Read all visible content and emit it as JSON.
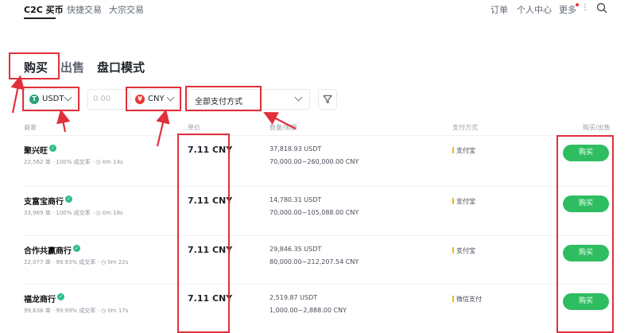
{
  "topnav": {
    "brand": "C2C 买币",
    "tabs": [
      "快捷交易",
      "大宗交易"
    ],
    "orders": "订单",
    "profile": "个人中心",
    "more": "更多"
  },
  "modes": {
    "buy": "购买",
    "sell": "出售",
    "book": "盘口模式"
  },
  "filters": {
    "coin": "USDT",
    "amount_placeholder": "0.00",
    "currency": "CNY",
    "payment": "全部支付方式"
  },
  "table": {
    "headers": {
      "merchant": "商家",
      "price": "单价",
      "qty_limit": "数量/限额",
      "payment": "支付方式",
      "action": "购买/出售"
    },
    "rows": [
      {
        "merchant": "聚兴旺",
        "stats": "22,562 单 · 100% 成交率 · ◷ 0m 14s",
        "price": "7.11 CNY",
        "qty": "37,818.93 USDT",
        "limit": "70,000.00~260,000.00 CNY",
        "pay": "支付宝",
        "btn": "购买"
      },
      {
        "merchant": "支富宝商行",
        "stats": "33,969 单 · 100% 成交率 · ◷ 0m 18s",
        "price": "7.11 CNY",
        "qty": "14,780.31 USDT",
        "limit": "70,000.00~105,088.00 CNY",
        "pay": "支付宝",
        "btn": "购买"
      },
      {
        "merchant": "合作共赢商行",
        "stats": "22,077 单 · 99.93% 成交率 · ◷ 0m 22s",
        "price": "7.11 CNY",
        "qty": "29,846.35 USDT",
        "limit": "80,000.00~212,207.54 CNY",
        "pay": "支付宝",
        "btn": "购买"
      },
      {
        "merchant": "福龙商行",
        "stats": "99,638 单 · 99.99% 成交率 · ◷ 0m 17s",
        "price": "7.11 CNY",
        "qty": "2,519.87 USDT",
        "limit": "1,000.00~2,888.00 CNY",
        "pay": "微信支付",
        "btn": "购买"
      }
    ]
  },
  "colors": {
    "accent_green": "#2ebd61",
    "annotation_red": "#e0303a",
    "tether": "#26a17b",
    "cny": "#e53935"
  }
}
